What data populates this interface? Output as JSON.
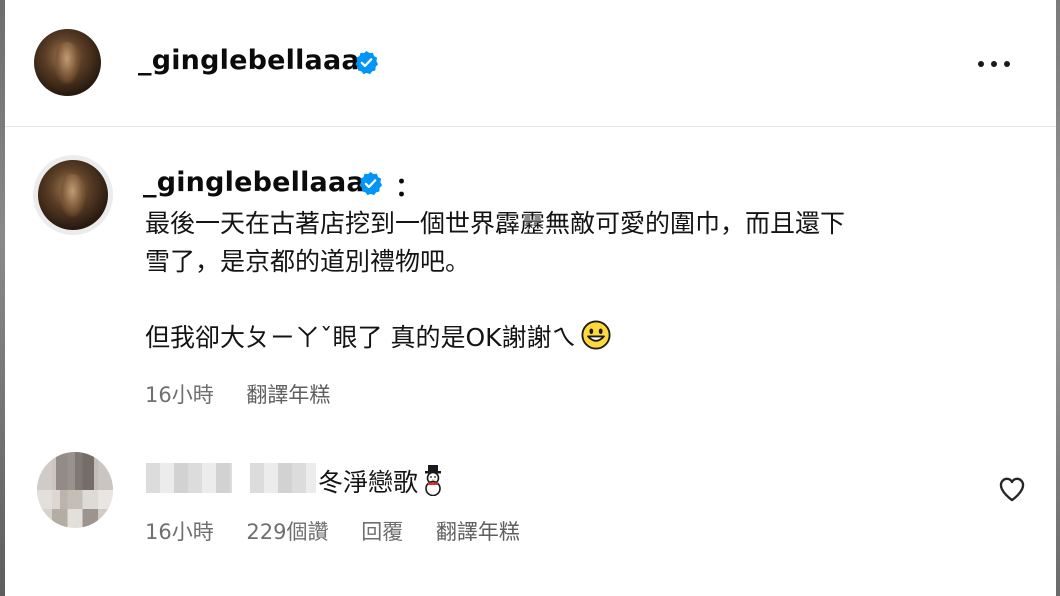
{
  "post": {
    "author": {
      "username": "_ginglebellaaa",
      "avatar_icon": "profile-avatar",
      "verified_icon": "verified-badge-icon"
    },
    "more_icon": "more-options-icon"
  },
  "caption": {
    "username": "_ginglebellaaa",
    "colon": "：",
    "line1": "最後一天在古著店挖到一個世界霹靂無敵可愛的圍巾，而且還下",
    "line2": "雪了，是京都的道別禮物吧。",
    "line3": "但我卻大ㄆㄧㄚˇ眼了 真的是OK謝謝ㄟ",
    "emoji": "grinning-face-emoji",
    "time": "16小時",
    "translate": "翻譯年糕"
  },
  "comment": {
    "username_blurred": true,
    "text": "冬淨戀歌",
    "emoji": "snowman-emoji",
    "time": "16小時",
    "likes": "229個讚",
    "reply": "回覆",
    "translate": "翻譯年糕",
    "heart_icon": "heart-outline-icon"
  },
  "colors": {
    "verified": "#0095f6",
    "meta_text": "#737373",
    "text": "#000000"
  }
}
